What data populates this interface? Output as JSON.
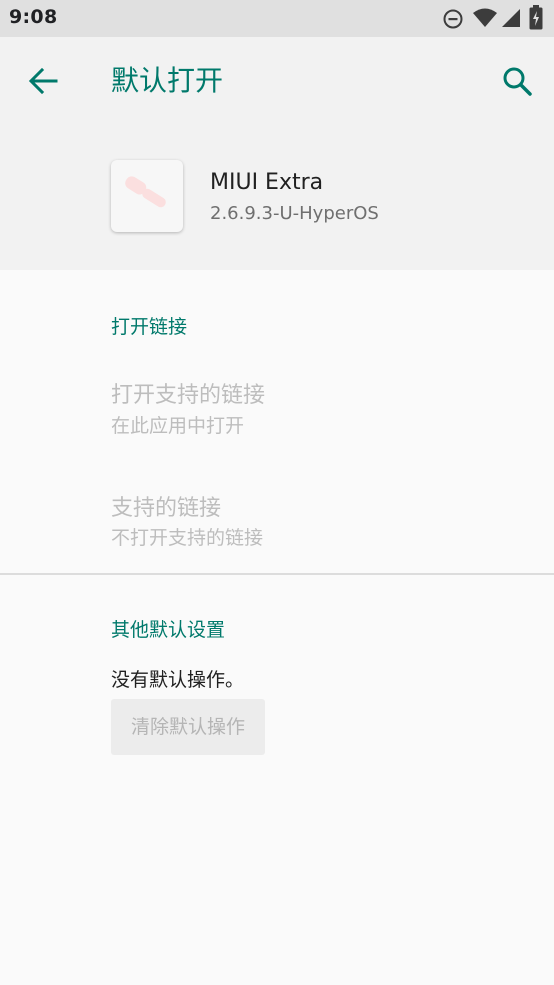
{
  "status_bar": {
    "time": "9:08",
    "icons": [
      "do-not-disturb-icon",
      "wifi-icon",
      "signal-icon",
      "battery-charging-icon"
    ]
  },
  "app_bar": {
    "title": "默认打开",
    "back_icon": "arrow-back-icon",
    "search_icon": "search-icon"
  },
  "app_info": {
    "name": "MIUI Extra",
    "version": "2.6.9.3-U-HyperOS"
  },
  "open_links": {
    "section_title": "打开链接",
    "items": [
      {
        "title": "打开支持的链接",
        "summary": "在此应用中打开"
      },
      {
        "title": "支持的链接",
        "summary": "不打开支持的链接"
      }
    ]
  },
  "other_defaults": {
    "section_title": "其他默认设置",
    "status_text": "没有默认操作。",
    "clear_button_label": "清除默认操作"
  },
  "colors": {
    "accent": "#00796b",
    "disabled_text": "#bdbdbd",
    "status_bar_bg": "#e0e0e0",
    "header_bg": "#f2f2f2",
    "page_bg": "#fafafa"
  }
}
